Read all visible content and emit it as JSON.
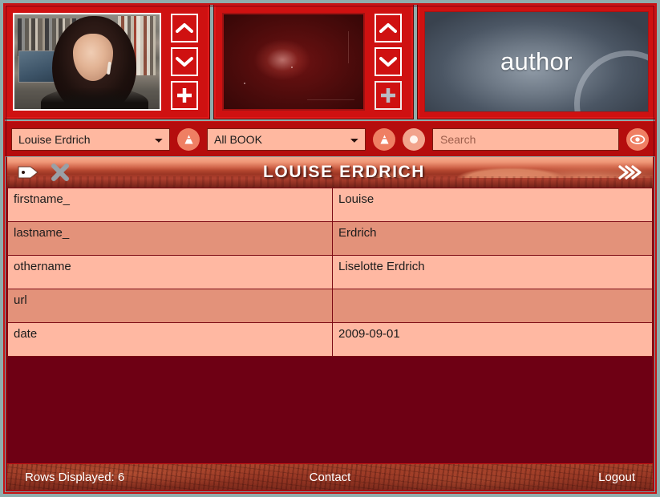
{
  "panels": [
    {
      "name": "author-photo-panel",
      "image_kind": "portrait-photo",
      "buttons": [
        {
          "name": "scroll-up-button",
          "icon": "chevron-up-icon"
        },
        {
          "name": "scroll-down-button",
          "icon": "chevron-down-icon"
        },
        {
          "name": "add-button",
          "icon": "plus-icon"
        }
      ]
    },
    {
      "name": "secondary-image-panel",
      "image_kind": "dark-red-nebula",
      "buttons": [
        {
          "name": "scroll-up-button",
          "icon": "chevron-up-icon"
        },
        {
          "name": "scroll-down-button",
          "icon": "chevron-down-icon"
        },
        {
          "name": "add-button",
          "icon": "plus-icon"
        }
      ]
    },
    {
      "name": "record-type-panel",
      "label": "author",
      "image_kind": "blue-grey-gradient"
    }
  ],
  "toolbar": {
    "author_select": {
      "value": "Louise Erdrich",
      "options": [
        "Louise Erdrich"
      ]
    },
    "author_filter_icon": "funnel-icon",
    "book_select": {
      "value": "All BOOK",
      "options": [
        "All BOOK"
      ]
    },
    "book_filter_icon": "funnel-icon",
    "circle_icon": "record-circle-icon",
    "search": {
      "placeholder": "Search",
      "value": ""
    },
    "view_icon": "eye-icon"
  },
  "titlebar": {
    "title": "LOUISE ERDRICH",
    "tag_icon": "tag-icon",
    "close_icon": "close-x-icon",
    "next_icon": "double-chevron-right-icon"
  },
  "table": {
    "rows": [
      {
        "key": "firstname_",
        "value": "Louise"
      },
      {
        "key": "lastname_",
        "value": "Erdrich"
      },
      {
        "key": "othername",
        "value": "Liselotte Erdrich"
      },
      {
        "key": "url",
        "value": ""
      },
      {
        "key": "date",
        "value": "2009-09-01"
      }
    ]
  },
  "footer": {
    "rows_displayed": "Rows Displayed: 6",
    "contact": "Contact",
    "logout": "Logout"
  },
  "colors": {
    "page_background": "#8fadac",
    "frame_red": "#c51313",
    "panel_red": "#cf1111",
    "toolbar_red": "#b50d0d",
    "content_maroon": "#6e0014",
    "row_odd": "#ffb8a2",
    "row_even": "#e3927a",
    "footer_rust": "#9c3a26",
    "accent_text": "#ffffff"
  }
}
